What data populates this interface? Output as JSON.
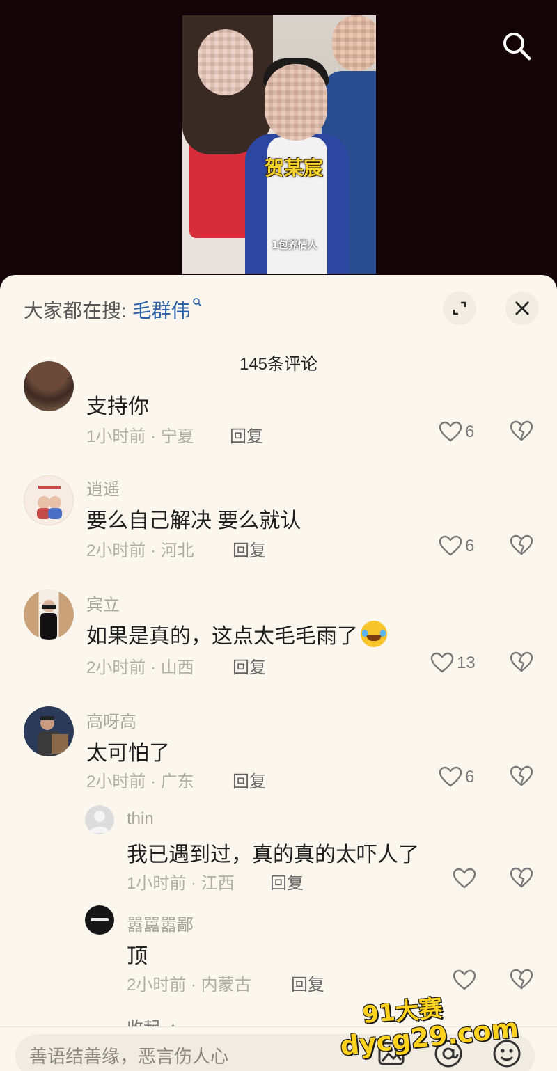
{
  "video": {
    "caption": "贺某宸",
    "subcaption": "1包养情人"
  },
  "header": {
    "search_prefix": "大家都在搜: ",
    "search_keyword": "毛群伟",
    "comment_count": "145条评论"
  },
  "comments": [
    {
      "name": "",
      "text": "支持你",
      "time": "1小时前 · 宁夏",
      "reply": "回复",
      "likes": "6"
    },
    {
      "name": "逍遥",
      "text": "要么自己解决 要么就认",
      "time": "2小时前 · 河北",
      "reply": "回复",
      "likes": "6"
    },
    {
      "name": "宾立",
      "text": "如果是真的，这点太毛毛雨了",
      "time": "2小时前 · 山西",
      "reply": "回复",
      "likes": "13"
    },
    {
      "name": "高呀高",
      "text": "太可怕了",
      "time": "2小时前 · 广东",
      "reply": "回复",
      "likes": "6"
    }
  ],
  "replies": [
    {
      "name": "thin",
      "text": "我已遇到过，真的真的太吓人了",
      "time": "1小时前 · 江西",
      "reply": "回复",
      "likes": ""
    },
    {
      "name": "嚣嚚嚣鄙",
      "text": "顶",
      "time": "2小时前 · 内蒙古",
      "reply": "回复",
      "likes": ""
    }
  ],
  "collapse_label": "收起 ▲",
  "input": {
    "placeholder": "善语结善缘，恶言伤人心"
  },
  "watermark": {
    "line1": "91大赛",
    "line2": "dycg29.com"
  },
  "colors": {
    "accent_link": "#2b5fa6",
    "sheet_bg": "#fbf7ee",
    "watermark": "#ffd21e"
  }
}
